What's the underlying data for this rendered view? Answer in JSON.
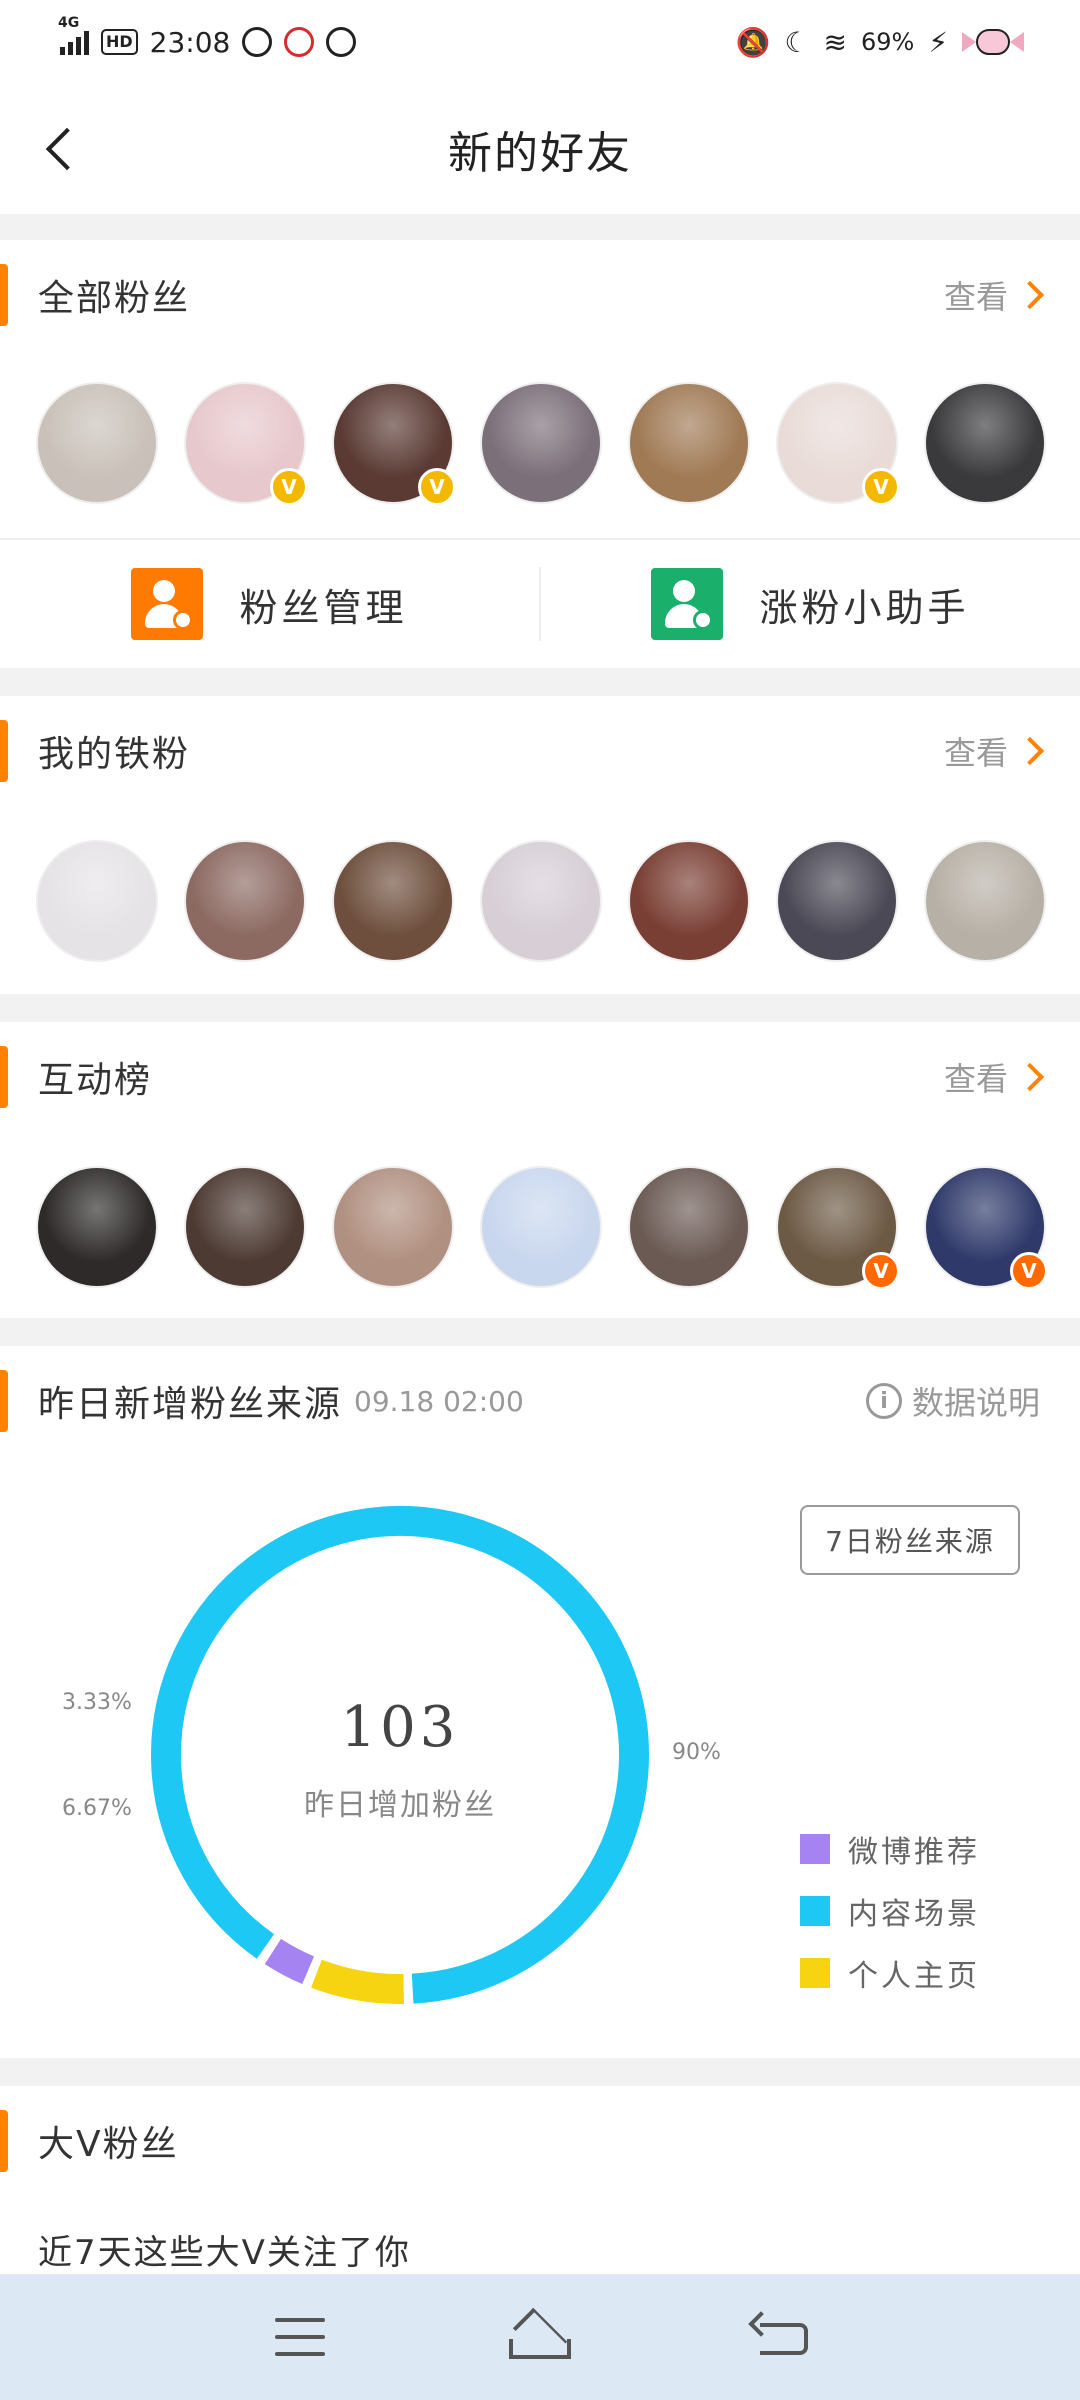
{
  "status_bar": {
    "network": "4G",
    "hd": "HD",
    "time": "23:08",
    "battery": "69%"
  },
  "header": {
    "title": "新的好友"
  },
  "sections": {
    "all_fans": {
      "title": "全部粉丝",
      "view_label": "查看",
      "avatars": [
        {
          "color": "#c9c1b9",
          "badge": null
        },
        {
          "color": "#e7c8cc",
          "badge": "V"
        },
        {
          "color": "#5a3a33",
          "badge": "V"
        },
        {
          "color": "#7b6f79",
          "badge": null
        },
        {
          "color": "#a07a55",
          "badge": null
        },
        {
          "color": "#e9dcd8",
          "badge": "V"
        },
        {
          "color": "#3a3a3d",
          "badge": null
        }
      ]
    },
    "tools": {
      "fan_manage": "粉丝管理",
      "fan_helper": "涨粉小助手"
    },
    "iron_fans": {
      "title": "我的铁粉",
      "view_label": "查看",
      "avatars": [
        {
          "color": "#e6e3e6",
          "badge": null
        },
        {
          "color": "#8c6a62",
          "badge": null
        },
        {
          "color": "#6e4f3d",
          "badge": null
        },
        {
          "color": "#d7ced6",
          "badge": null
        },
        {
          "color": "#7a3f34",
          "badge": null
        },
        {
          "color": "#4b4955",
          "badge": null
        },
        {
          "color": "#b7b0a6",
          "badge": null
        }
      ]
    },
    "interaction": {
      "title": "互动榜",
      "view_label": "查看",
      "avatars": [
        {
          "color": "#2e2a2a",
          "badge": null
        },
        {
          "color": "#4d3a33",
          "badge": null
        },
        {
          "color": "#b09080",
          "badge": null
        },
        {
          "color": "#c9d7ee",
          "badge": null
        },
        {
          "color": "#6b5a54",
          "badge": null
        },
        {
          "color": "#6d5a45",
          "badge": "V"
        },
        {
          "color": "#2f3a6a",
          "badge": "V"
        }
      ]
    },
    "fan_source": {
      "title": "昨日新增粉丝来源",
      "timestamp": "09.18 02:00",
      "info_label": "数据说明",
      "seven_day_button": "7日粉丝来源",
      "center_value": "103",
      "center_label": "昨日增加粉丝"
    },
    "big_v": {
      "title": "大V粉丝",
      "subtitle": "近7天这些大V关注了你"
    }
  },
  "chart_data": {
    "type": "pie",
    "variant": "donut",
    "total": 103,
    "slices": [
      {
        "label": "内容场景",
        "value": 90,
        "display": "90%",
        "color": "#1ec8f4"
      },
      {
        "label": "个人主页",
        "value": 6.67,
        "display": "6.67%",
        "color": "#f7d412"
      },
      {
        "label": "微博推荐",
        "value": 3.33,
        "display": "3.33%",
        "color": "#a583f1"
      }
    ],
    "legend": [
      {
        "label": "微博推荐",
        "color": "#a583f1"
      },
      {
        "label": "内容场景",
        "color": "#1ec8f4"
      },
      {
        "label": "个人主页",
        "color": "#f7d412"
      }
    ],
    "legend_position": "right"
  },
  "colors": {
    "accent": "#ff8200",
    "gold_badge": "#f5b800",
    "orange_badge": "#ff6a00"
  }
}
